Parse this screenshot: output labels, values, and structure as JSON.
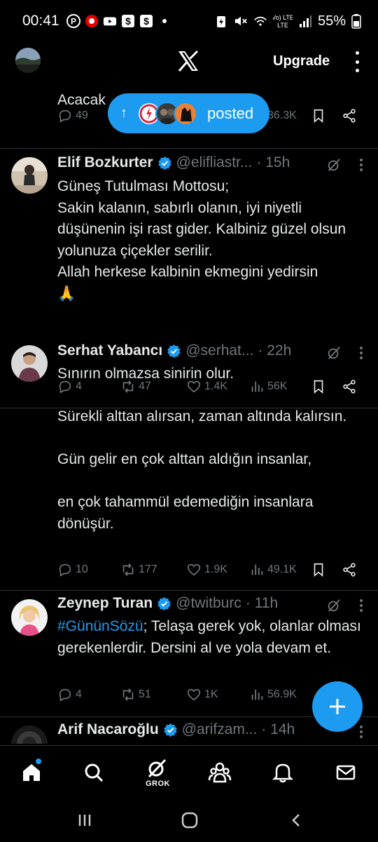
{
  "status_bar": {
    "time": "00:41",
    "battery_pct": "55%",
    "network": "Vo) LTE",
    "left_icons": [
      "pinterest-icon",
      "vodafone-icon",
      "youtube-icon",
      "dollar-app-icon",
      "dollar-app-icon",
      "dot-icon"
    ],
    "right_icons": [
      "battery-saver-icon",
      "mute-icon",
      "wifi-icon",
      "lte-icon",
      "signal-icon",
      "battery-icon"
    ]
  },
  "header": {
    "logo": "x-logo-icon",
    "upgrade_label": "Upgrade"
  },
  "posted_pill": {
    "label": "posted"
  },
  "tweets": [
    {
      "text": "Acacak",
      "replies": "49",
      "views": "36.3K"
    },
    {
      "name": "Elif Bozkurter",
      "handle": "@elifliastr...",
      "time": "· 15h",
      "text": "Güneş Tutulması Mottosu;\nSakin kalanın, sabırlı olanın, iyi niyetli düşünenin işi rast gider. Kalbiniz güzel olsun yolunuza çiçekler serilir.\nAllah herkese kalbinin ekmegini yedirsin\n🙏",
      "replies": "4",
      "reposts": "47",
      "likes": "1.4K",
      "views": "56K"
    },
    {
      "name": "Serhat Yabancı",
      "handle": "@serhat...",
      "time": "· 22h",
      "text": "Sınırın olmazsa sinirin olur.\n\nSürekli alttan alırsan, zaman altında kalırsın.\n\nGün gelir en çok alttan aldığın insanlar,\n\nen çok tahammül edemediğin insanlara dönüşür.",
      "replies": "10",
      "reposts": "177",
      "likes": "1.9K",
      "views": "49.1K"
    },
    {
      "name": "Zeynep Turan",
      "handle": "@twitburc",
      "time": "· 11h",
      "hashtag": "#GününSözü",
      "text": "; Telaşa gerek yok, olanlar olması gerekenlerdir. Dersini al ve yola devam et.",
      "replies": "4",
      "reposts": "51",
      "likes": "1K",
      "views": "56.9K"
    },
    {
      "name": "Arif Nacaroğlu",
      "handle": "@arifzam...",
      "time": "· 14h"
    }
  ],
  "bottom_nav": {
    "items": [
      "home-icon",
      "search-icon",
      "grok-icon",
      "communities-icon",
      "notifications-icon",
      "messages-icon"
    ],
    "grok_label": "GROK"
  }
}
